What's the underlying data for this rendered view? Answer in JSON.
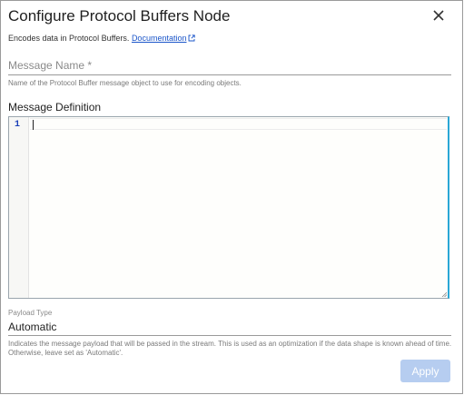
{
  "dialog": {
    "title": "Configure Protocol Buffers Node",
    "subtitle": "Encodes data in Protocol Buffers.",
    "doc_link": "Documentation"
  },
  "message_name": {
    "placeholder": "Message Name *",
    "value": "",
    "helper": "Name of the Protocol Buffer message object to use for encoding objects."
  },
  "message_definition": {
    "label": "Message Definition",
    "line_numbers": [
      "1"
    ]
  },
  "payload_type": {
    "label": "Payload Type",
    "value": "Automatic",
    "helper": "Indicates the message payload that will be passed in the stream. This is used as an optimization if the data shape is known ahead of time. Otherwise, leave set as 'Automatic'."
  },
  "footer": {
    "apply_label": "Apply"
  },
  "icons": {
    "close": "close-icon",
    "external_link": "external-link-icon"
  },
  "colors": {
    "link": "#1a55c9",
    "editor_focus": "#2aa7d5",
    "line_number": "#1a3fb8",
    "apply_disabled": "#b6cdf0"
  }
}
